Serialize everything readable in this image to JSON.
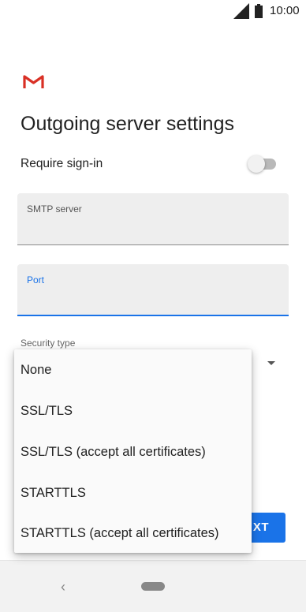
{
  "status_bar": {
    "time": "10:00"
  },
  "page": {
    "title": "Outgoing server settings"
  },
  "require_signin": {
    "label": "Require sign-in",
    "enabled": false
  },
  "smtp_server": {
    "label": "SMTP server",
    "value": ""
  },
  "port": {
    "label": "Port",
    "value": ""
  },
  "security_type": {
    "label": "Security type",
    "options": [
      "None",
      "SSL/TLS",
      "SSL/TLS (accept all certificates)",
      "STARTTLS",
      "STARTTLS (accept all certificates)"
    ]
  },
  "next_button": {
    "label": "XT"
  },
  "colors": {
    "accent": "#1a73e8",
    "gmail_red": "#d93025"
  },
  "icons": [
    "signal-icon",
    "battery-icon",
    "gmail-logo-icon",
    "chevron-down-icon",
    "back-icon",
    "home-icon"
  ]
}
